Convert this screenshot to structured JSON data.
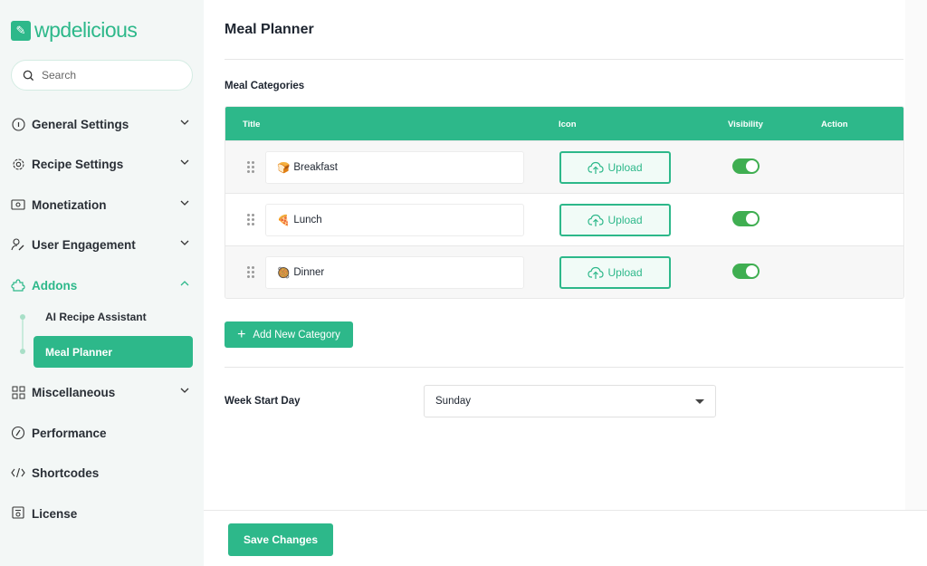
{
  "brand": {
    "prefix": "wp",
    "name": "delicious"
  },
  "search": {
    "placeholder": "Search"
  },
  "sidebar": {
    "items": [
      {
        "label": "General Settings"
      },
      {
        "label": "Recipe Settings"
      },
      {
        "label": "Monetization"
      },
      {
        "label": "User Engagement"
      },
      {
        "label": "Addons"
      },
      {
        "label": "Miscellaneous"
      },
      {
        "label": "Performance"
      },
      {
        "label": "Shortcodes"
      },
      {
        "label": "License"
      }
    ],
    "addons_sub": [
      {
        "label": "AI Recipe Assistant"
      },
      {
        "label": "Meal Planner"
      }
    ]
  },
  "page": {
    "title": "Meal Planner",
    "section": "Meal Categories"
  },
  "table": {
    "headers": {
      "title": "Title",
      "icon": "Icon",
      "visibility": "Visibility",
      "action": "Action"
    },
    "rows": [
      {
        "emoji": "🍞",
        "title": "Breakfast",
        "upload": "Upload",
        "visible": true
      },
      {
        "emoji": "🍕",
        "title": "Lunch",
        "upload": "Upload",
        "visible": true
      },
      {
        "emoji": "🥘",
        "title": "Dinner",
        "upload": "Upload",
        "visible": true
      }
    ]
  },
  "add_category": "Add New Category",
  "week": {
    "label": "Week Start Day",
    "value": "Sunday"
  },
  "save": "Save Changes",
  "colors": {
    "accent": "#2db88a",
    "toggle": "#3fae51",
    "sidebar_bg": "#f3f7f6"
  }
}
